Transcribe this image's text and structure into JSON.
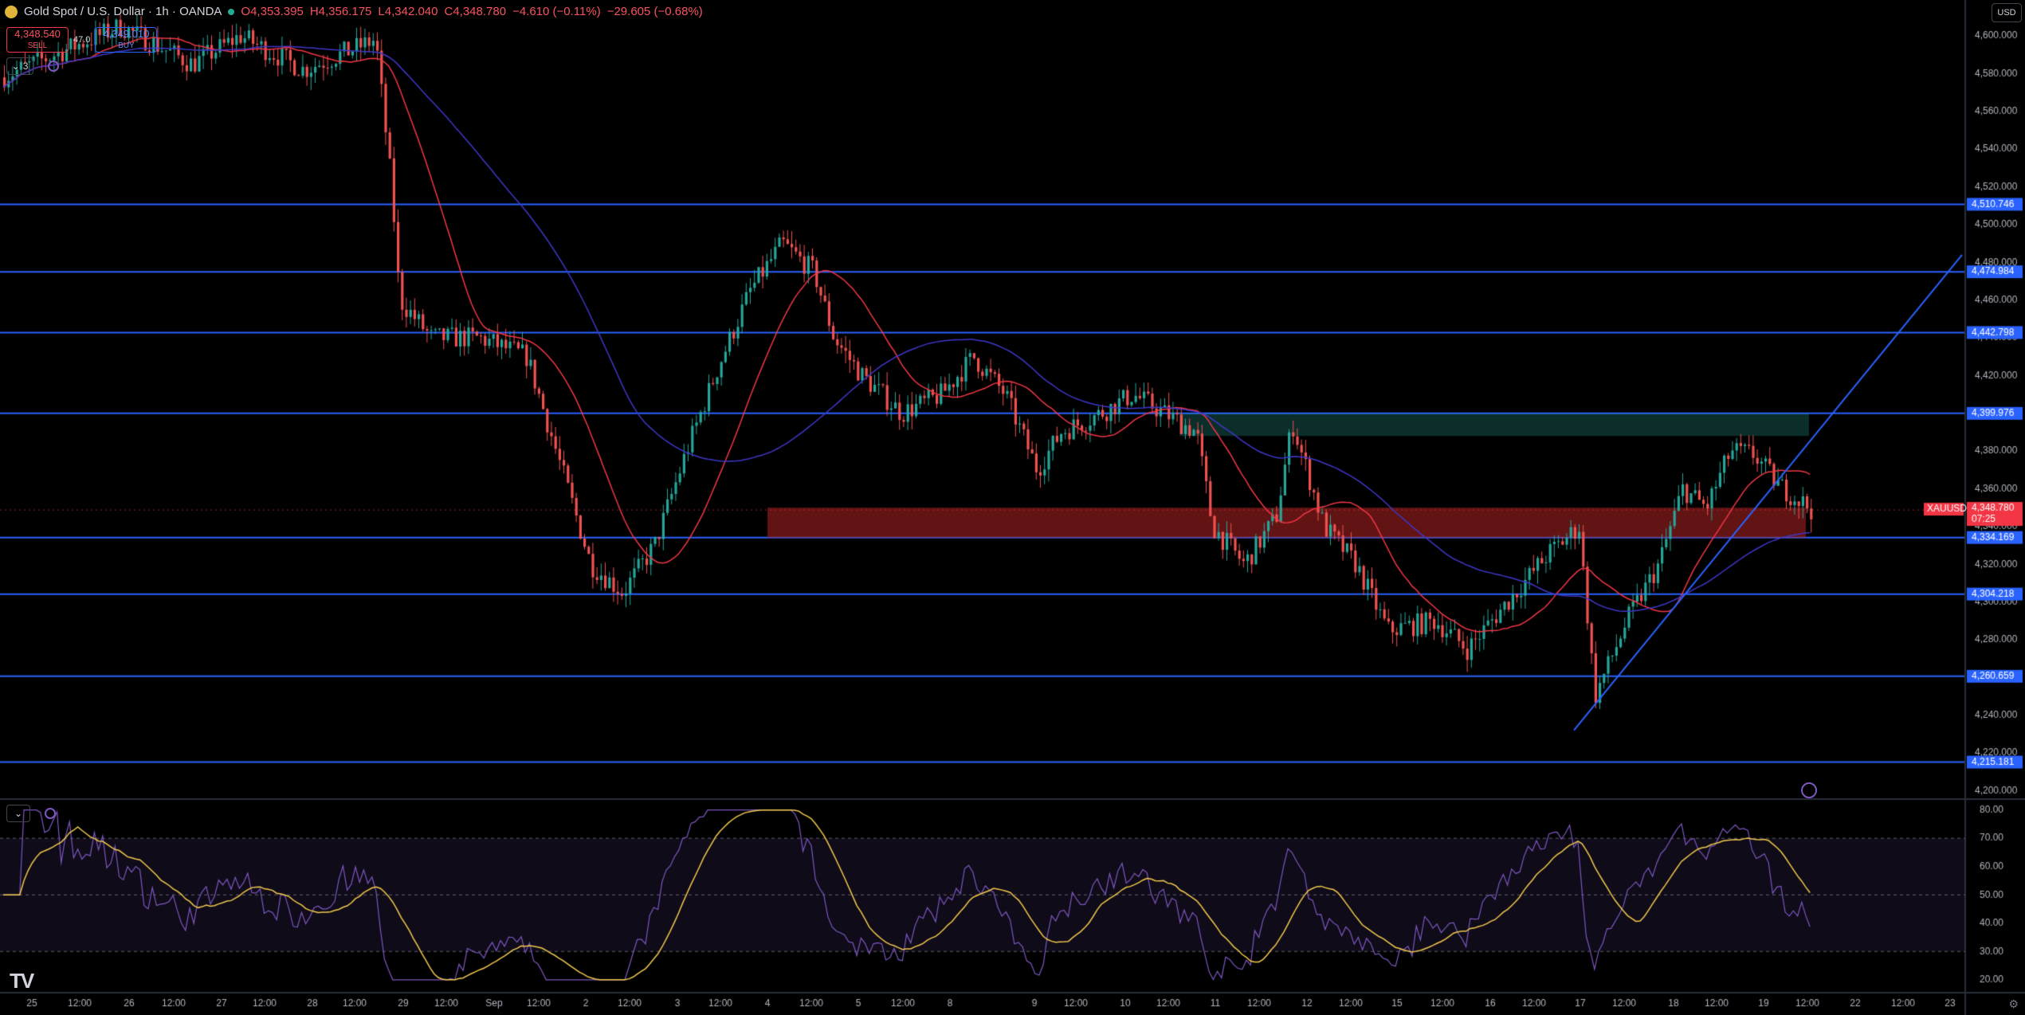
{
  "header": {
    "symbol_title": "Gold Spot / U.S. Dollar · 1h · OANDA",
    "open": "O4,353.395",
    "high": "H4,356.175",
    "low": "L4,342.040",
    "close": "C4,348.780",
    "change": "−4.610 (−0.11%)",
    "change2": "−29.605 (−0.68%)"
  },
  "trade": {
    "sell_price": "4,348.540",
    "sell_label": "SELL",
    "spread": "47.0",
    "buy_price": "4,349.010",
    "buy_label": "BUY"
  },
  "indicators_count": "3",
  "currency": "USD",
  "price_axis": {
    "ticks": [
      "4,600.000",
      "4,580.000",
      "4,560.000",
      "4,540.000",
      "4,520.000",
      "4,500.000",
      "4,480.000",
      "4,460.000",
      "4,440.000",
      "4,420.000",
      "4,400.000",
      "4,380.000",
      "4,360.000",
      "4,340.000",
      "4,320.000",
      "4,300.000",
      "4,280.000",
      "4,260.000",
      "4,240.000",
      "4,220.000",
      "4,200.000"
    ],
    "levels": [
      {
        "price": 4510.746,
        "label": "4,510.746"
      },
      {
        "price": 4474.984,
        "label": "4,474.984"
      },
      {
        "price": 4442.798,
        "label": "4,442.798"
      },
      {
        "price": 4399.976,
        "label": "4,399.976"
      },
      {
        "price": 4334.169,
        "label": "4,334.169"
      },
      {
        "price": 4304.218,
        "label": "4,304.218"
      },
      {
        "price": 4260.659,
        "label": "4,260.659"
      },
      {
        "price": 4215.181,
        "label": "4,215.181"
      }
    ],
    "last_price": {
      "symbol": "XAUUSD",
      "price": "4,348.780",
      "countdown": "07:25"
    }
  },
  "rsi_axis": {
    "ticks": [
      "80.00",
      "70.00",
      "60.00",
      "50.00",
      "40.00",
      "30.00",
      "20.00"
    ]
  },
  "time_axis": {
    "labels": [
      "25",
      "12:00",
      "26",
      "12:00",
      "27",
      "12:00",
      "28",
      "12:00",
      "29",
      "12:00",
      "Sep",
      "12:00",
      "2",
      "12:00",
      "3",
      "12:00",
      "4",
      "12:00",
      "5",
      "12:00",
      "8",
      "9",
      "12:00",
      "10",
      "12:00",
      "11",
      "12:00",
      "12",
      "12:00",
      "15",
      "12:00",
      "16",
      "12:00",
      "17",
      "12:00",
      "18",
      "12:00",
      "19",
      "12:00",
      "22",
      "12:00",
      "23"
    ]
  },
  "colors": {
    "level_line": "#2962ff",
    "bull": "#26a69a",
    "bear": "#ef5350",
    "ma_fast": "#f23645",
    "ma_slow": "#3f37c9",
    "rsi": "#7e57c2",
    "rsi_ma": "#f2c94c"
  },
  "icons": [
    "gold-symbol-icon",
    "chevron-down-icon",
    "refresh-icon",
    "lightning-icon",
    "tradingview-logo",
    "settings-icon"
  ]
}
